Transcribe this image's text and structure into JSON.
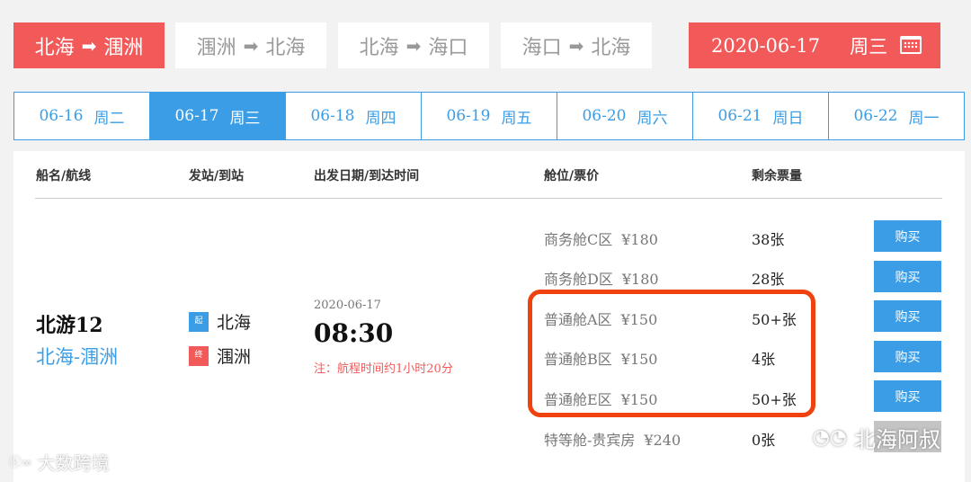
{
  "routes": [
    {
      "from": "北海",
      "to": "涠洲",
      "active": true
    },
    {
      "from": "涠洲",
      "to": "北海",
      "active": false
    },
    {
      "from": "北海",
      "to": "海口",
      "active": false
    },
    {
      "from": "海口",
      "to": "北海",
      "active": false
    }
  ],
  "date_picker": {
    "date": "2020-06-17",
    "weekday": "周三",
    "icon": "calendar-icon"
  },
  "date_tabs": [
    {
      "date": "06-16",
      "weekday": "周二"
    },
    {
      "date": "06-17",
      "weekday": "周三"
    },
    {
      "date": "06-18",
      "weekday": "周四"
    },
    {
      "date": "06-19",
      "weekday": "周五"
    },
    {
      "date": "06-20",
      "weekday": "周六"
    },
    {
      "date": "06-21",
      "weekday": "周日"
    },
    {
      "date": "06-22",
      "weekday": "周一"
    }
  ],
  "table": {
    "headers": {
      "ship": "船名/航线",
      "station": "发站/到站",
      "time": "出发日期/到达时间",
      "cabin": "舱位/票价",
      "remain": "剩余票量"
    },
    "ship_name": "北游12",
    "ship_route": "北海-涠洲",
    "start_badge": "起",
    "start_station": "北海",
    "end_badge": "终",
    "end_station": "涠洲",
    "dep_date": "2020-06-17",
    "dep_time": "08:30",
    "note": "注：航程时间约1小时20分",
    "cabins": [
      {
        "name": "商务舱C区",
        "price": "¥180",
        "remain": "38张",
        "buy": "购买"
      },
      {
        "name": "商务舱D区",
        "price": "¥180",
        "remain": "28张",
        "buy": "购买"
      },
      {
        "name": "普通舱A区",
        "price": "¥150",
        "remain": "50+张",
        "buy": "购买"
      },
      {
        "name": "普通舱B区",
        "price": "¥150",
        "remain": "4张",
        "buy": "购买"
      },
      {
        "name": "普通舱E区",
        "price": "¥150",
        "remain": "50+张",
        "buy": "购买"
      },
      {
        "name": "特等舱-贵宾房",
        "price": "¥240",
        "remain": "0张",
        "buy": ""
      }
    ]
  },
  "watermarks": {
    "left": "大数跨境",
    "right": "北海阿叔"
  },
  "colors": {
    "accent_red": "#f25a5a",
    "accent_blue": "#3a9de6",
    "highlight": "#f0420f"
  }
}
